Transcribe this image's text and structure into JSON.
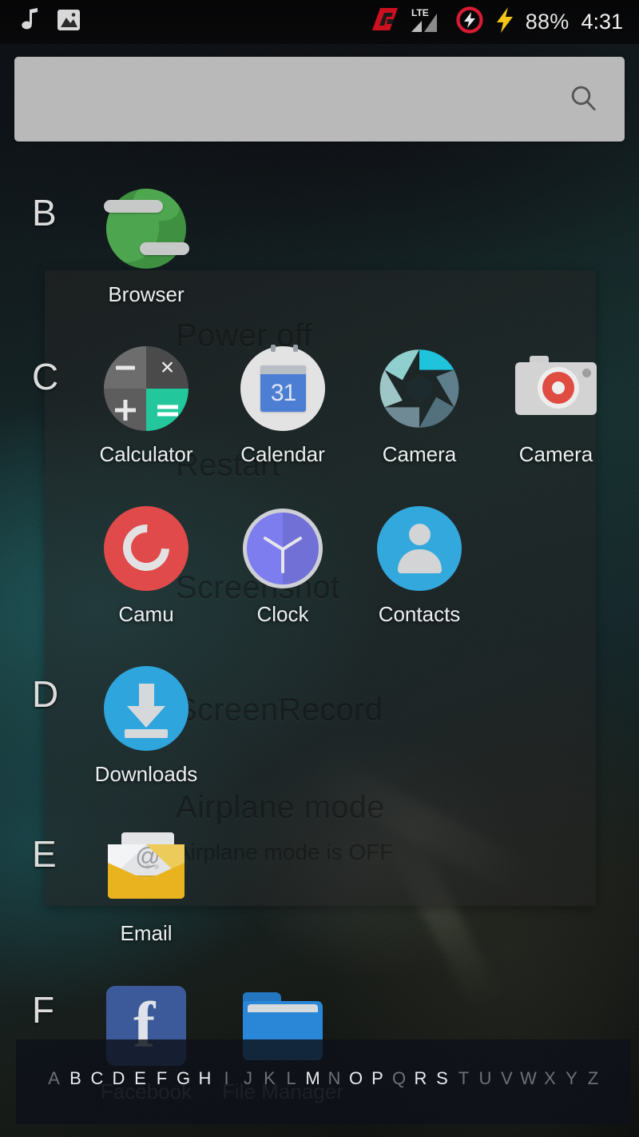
{
  "status_bar": {
    "left_icons": [
      "music-note-icon",
      "image-icon"
    ],
    "right_icons": [
      "carrier-logo-icon",
      "lte-signal-icon",
      "do-not-disturb-icon",
      "charging-bolt-icon"
    ],
    "network_type": "LTE",
    "battery_percent": "88%",
    "time": "4:31"
  },
  "search": {
    "value": "",
    "placeholder": "",
    "icon": "search-icon"
  },
  "ghost_dialog": {
    "title": "power-menu-overlay",
    "items": [
      {
        "label": "Power off",
        "sub": ""
      },
      {
        "label": "Restart",
        "sub": ""
      },
      {
        "label": "Screenshot",
        "sub": ""
      },
      {
        "label": "ScreenRecord",
        "sub": ""
      },
      {
        "label": "Airplane mode",
        "sub": "Airplane mode is OFF"
      }
    ]
  },
  "app_drawer": {
    "sections": [
      {
        "letter": "B",
        "apps": [
          {
            "name": "Browser",
            "icon": "browser-globe-icon"
          }
        ]
      },
      {
        "letter": "C",
        "apps": [
          {
            "name": "Calculator",
            "icon": "calculator-icon"
          },
          {
            "name": "Calendar",
            "icon": "calendar-icon",
            "day": "31"
          },
          {
            "name": "Camera",
            "icon": "camera-aperture-icon"
          },
          {
            "name": "Camera",
            "icon": "camera-body-icon"
          },
          {
            "name": "Camu",
            "icon": "camu-icon"
          },
          {
            "name": "Clock",
            "icon": "clock-icon"
          },
          {
            "name": "Contacts",
            "icon": "contacts-icon"
          }
        ]
      },
      {
        "letter": "D",
        "apps": [
          {
            "name": "Downloads",
            "icon": "download-arrow-icon"
          }
        ]
      },
      {
        "letter": "E",
        "apps": [
          {
            "name": "Email",
            "icon": "email-envelope-icon"
          }
        ]
      },
      {
        "letter": "F",
        "apps": [
          {
            "name": "Facebook",
            "icon": "facebook-icon"
          },
          {
            "name": "File Manager",
            "icon": "folder-icon"
          }
        ]
      }
    ],
    "calculator_glyphs": {
      "subtract": "−",
      "multiply": "×",
      "add": "+",
      "equals": "="
    },
    "email_at": "@",
    "facebook_letter": "f"
  },
  "alpha_index": {
    "letters": [
      "A",
      "B",
      "C",
      "D",
      "E",
      "F",
      "G",
      "H",
      "I",
      "J",
      "K",
      "L",
      "M",
      "N",
      "O",
      "P",
      "Q",
      "R",
      "S",
      "T",
      "U",
      "V",
      "W",
      "X",
      "Y",
      "Z"
    ],
    "active": [
      "B",
      "C",
      "D",
      "E",
      "F",
      "G",
      "H",
      "M",
      "O",
      "P",
      "R",
      "S"
    ]
  },
  "colors": {
    "accent_blue": "#2fa5dd",
    "search_bg": "#b9b9b9",
    "calc_green": "#22c79b",
    "email_yellow": "#eab92a",
    "facebook_blue": "#3c5a99",
    "folder_blue": "#2a86d6",
    "camu_red": "#e04a4a",
    "battery_bolt": "#f5c518"
  }
}
